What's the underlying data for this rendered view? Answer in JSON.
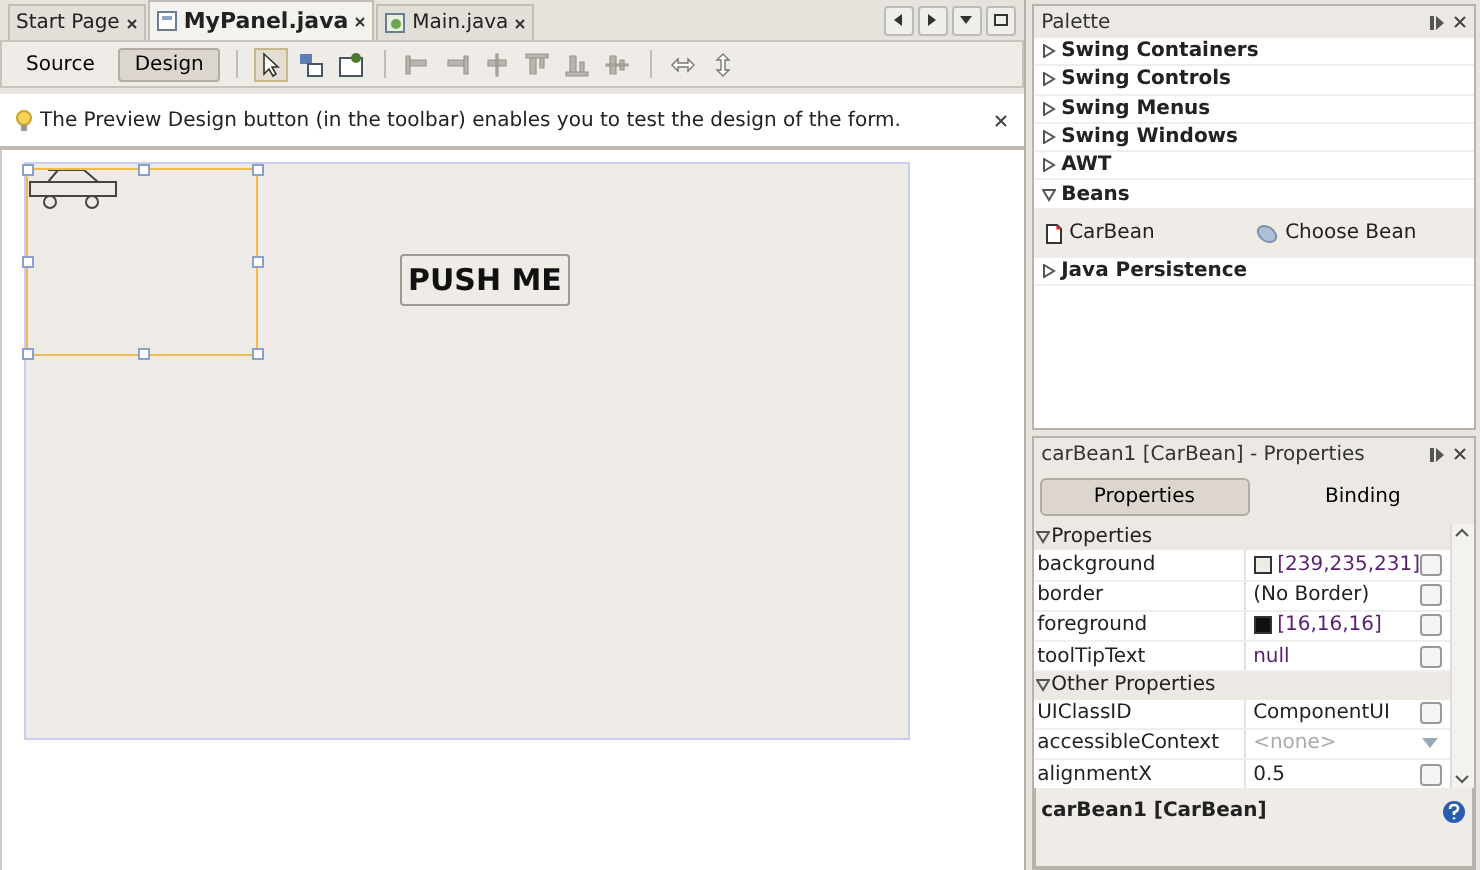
{
  "editor_tabs": [
    {
      "label": "Start Page",
      "selected": false
    },
    {
      "label": "MyPanel.java",
      "selected": true
    },
    {
      "label": "Main.java",
      "selected": false
    }
  ],
  "view_modes": [
    {
      "label": "Source",
      "selected": false
    },
    {
      "label": "Design",
      "selected": true
    }
  ],
  "hint": {
    "text": "The Preview Design button (in the toolbar) enables you to test the design of the form."
  },
  "canvas": {
    "components": [
      {
        "kind": "bean",
        "selected": true
      },
      {
        "kind": "button",
        "label": "PUSH ME",
        "selected": false
      }
    ]
  },
  "palette": {
    "title": "Palette",
    "categories": [
      {
        "label": "Swing Containers",
        "expanded": false
      },
      {
        "label": "Swing Controls",
        "expanded": false
      },
      {
        "label": "Swing Menus",
        "expanded": false
      },
      {
        "label": "Swing Windows",
        "expanded": false
      },
      {
        "label": "AWT",
        "expanded": false
      },
      {
        "label": "Beans",
        "expanded": true,
        "items": [
          {
            "label": "CarBean"
          },
          {
            "label": "Choose Bean"
          }
        ]
      },
      {
        "label": "Java Persistence",
        "expanded": false
      }
    ]
  },
  "properties": {
    "title": "carBean1 [CarBean] - Properties",
    "tabs": [
      {
        "label": "Properties",
        "selected": true
      },
      {
        "label": "Binding",
        "selected": false
      }
    ],
    "sections": [
      {
        "label": "Properties",
        "expanded": true,
        "rows": [
          {
            "name": "background",
            "value": "[239,235,231]",
            "kind": "color",
            "color": "#efebe7",
            "modified": true
          },
          {
            "name": "border",
            "value": "(No Border)",
            "kind": "text",
            "modified": false
          },
          {
            "name": "foreground",
            "value": "[16,16,16]",
            "kind": "color",
            "color": "#101010",
            "modified": true
          },
          {
            "name": "toolTipText",
            "value": "null",
            "kind": "text",
            "modified": true
          }
        ]
      },
      {
        "label": "Other Properties",
        "expanded": true,
        "rows": [
          {
            "name": "UIClassID",
            "value": "ComponentUI",
            "kind": "text",
            "modified": false
          },
          {
            "name": "accessibleContext",
            "value": "<none>",
            "kind": "combo",
            "modified": false
          },
          {
            "name": "alignmentX",
            "value": "0.5",
            "kind": "text",
            "modified": false
          }
        ]
      }
    ],
    "footer": "carBean1 [CarBean]"
  }
}
